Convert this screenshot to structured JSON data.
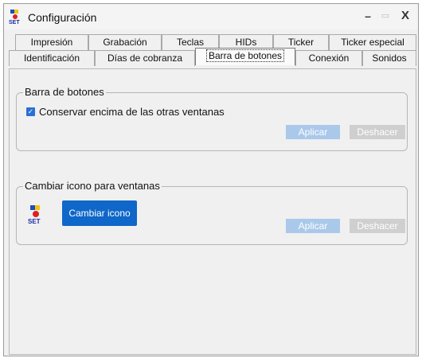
{
  "window": {
    "title": "Configuración",
    "controls": {
      "minimize": "–",
      "maximize": "▭",
      "close": "X"
    }
  },
  "tabs": {
    "row1": [
      "Impresión",
      "Grabación",
      "Teclas",
      "HIDs",
      "Ticker",
      "Ticker especial"
    ],
    "row2": [
      "Identificación",
      "Días de cobranza",
      "Barra de botones",
      "Conexión",
      "Sonidos"
    ],
    "active": "Barra de botones"
  },
  "toolbar_group": {
    "title": "Barra de botones",
    "checkbox_label": "Conservar encima de las otras ventanas",
    "checked": true,
    "apply_label": "Aplicar",
    "undo_label": "Deshacer"
  },
  "icon_group": {
    "title": "Cambiar icono para ventanas",
    "logo_text": "SET",
    "change_icon_label": "Cambiar icono",
    "apply_label": "Aplicar",
    "undo_label": "Deshacer"
  },
  "colors": {
    "primary_button": "#0e67c9",
    "checkbox": "#2a6fd6",
    "disabled_apply": "#a9c8ea",
    "disabled_undo": "#cfcfcf"
  }
}
